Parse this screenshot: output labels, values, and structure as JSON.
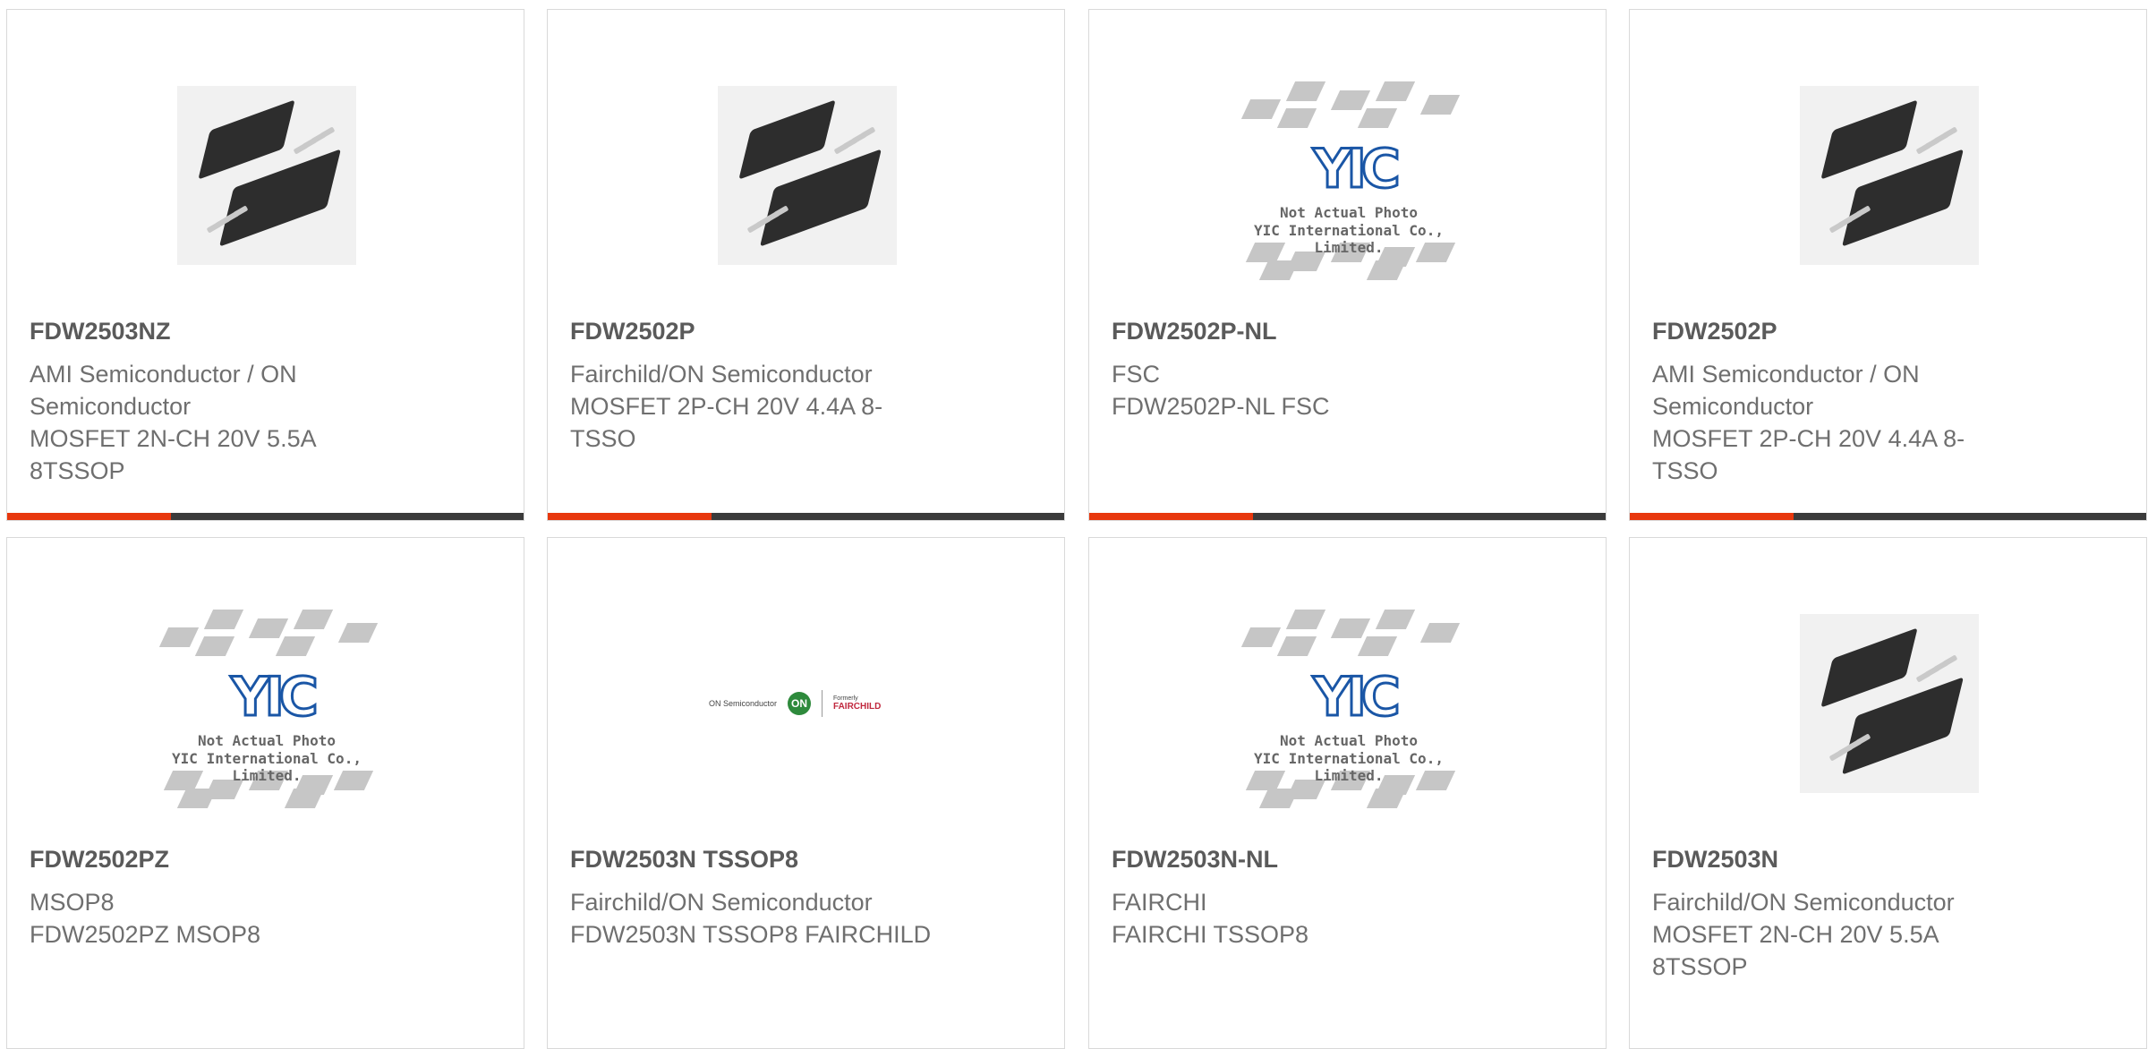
{
  "cards": [
    {
      "image": "chip-photo",
      "title": "FDW2503NZ",
      "lines": [
        "AMI Semiconductor / ON",
        "Semiconductor",
        "MOSFET 2N-CH 20V 5.5A",
        "8TSSOP"
      ],
      "show_bar": true
    },
    {
      "image": "chip-photo",
      "title": "FDW2502P",
      "lines": [
        "Fairchild/ON Semiconductor",
        "MOSFET 2P-CH 20V 4.4A 8-",
        "TSSO",
        ""
      ],
      "show_bar": true
    },
    {
      "image": "yic-placeholder",
      "title": "FDW2502P-NL",
      "lines": [
        "FSC",
        "FDW2502P-NL FSC",
        "",
        ""
      ],
      "show_bar": true
    },
    {
      "image": "chip-photo",
      "title": "FDW2502P",
      "lines": [
        "AMI Semiconductor / ON",
        "Semiconductor",
        "MOSFET 2P-CH 20V 4.4A 8-",
        "TSSO"
      ],
      "show_bar": true
    },
    {
      "image": "yic-placeholder",
      "title": "FDW2502PZ",
      "lines": [
        "MSOP8",
        "FDW2502PZ MSOP8",
        "",
        ""
      ],
      "show_bar": false
    },
    {
      "image": "brand-logos",
      "title": "FDW2503N TSSOP8",
      "lines": [
        "Fairchild/ON Semiconductor",
        "FDW2503N TSSOP8 FAIRCHILD",
        "",
        ""
      ],
      "show_bar": false
    },
    {
      "image": "yic-placeholder",
      "title": "FDW2503N-NL",
      "lines": [
        "FAIRCHI",
        "FAIRCHI TSSOP8",
        "",
        ""
      ],
      "show_bar": false
    },
    {
      "image": "chip-photo",
      "title": "FDW2503N",
      "lines": [
        "Fairchild/ON Semiconductor",
        "MOSFET 2N-CH 20V 5.5A",
        "8TSSOP",
        ""
      ],
      "show_bar": false
    }
  ],
  "yic": {
    "logo": "YIC",
    "line1": "Not Actual Photo",
    "line2": "YIC International Co., Limited."
  },
  "brand_logos": {
    "on_text": "ON Semiconductor",
    "on_mark": "ON",
    "formerly": "Formerly",
    "fairchild": "FAIRCHILD"
  },
  "colors": {
    "accent": "#e8370d",
    "bar": "#3b3b3b",
    "title": "#5a5a5a",
    "text": "#6f6f6f"
  }
}
